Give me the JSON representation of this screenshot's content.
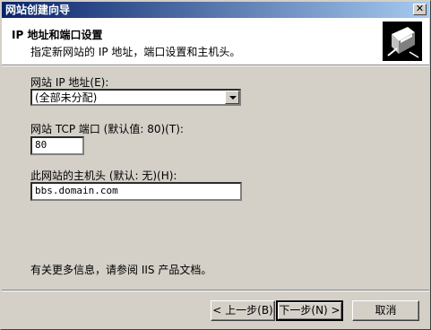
{
  "window": {
    "title": "网站创建向导",
    "close_label": "✕"
  },
  "header": {
    "title": "IP 地址和端口设置",
    "subtitle": "指定新网站的 IP 地址，端口设置和主机头。",
    "icon": "wizard-book-icon"
  },
  "form": {
    "ip_label": "网站 IP 地址(E):",
    "ip_value": "(全部未分配)",
    "port_label": "网站 TCP 端口 (默认值: 80)(T):",
    "port_value": "80",
    "host_label": "此网站的主机头 (默认: 无)(H):",
    "host_value": "bbs.domain.com"
  },
  "info_text": "有关更多信息，请参阅 IIS 产品文档。",
  "buttons": {
    "back": "< 上一步(B)",
    "next": "下一步(N) >",
    "cancel": "取消"
  }
}
